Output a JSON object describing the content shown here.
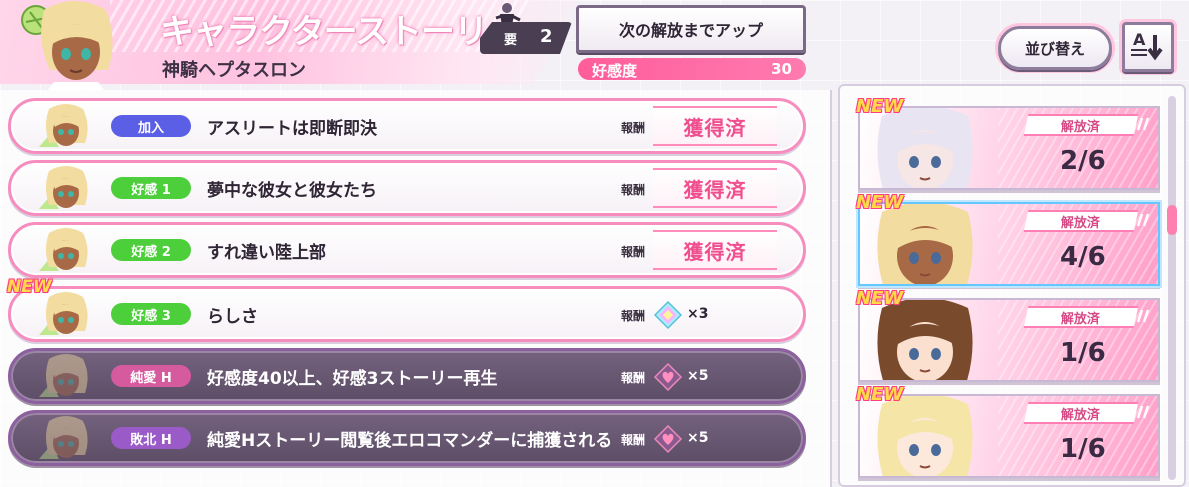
{
  "header": {
    "title": "キャラクターストーリー",
    "character_name": "神騎ヘプタスロン",
    "requirement": {
      "label": "要",
      "value": "2"
    },
    "unlock_button_label": "次の解放までアップ",
    "affinity": {
      "label": "好感度",
      "value": "30"
    }
  },
  "stories": [
    {
      "tag": "加入",
      "tag_color": "#5b5fe6",
      "title": "アスリートは即断即決",
      "reward_label": "報酬",
      "reward_text": "獲得済",
      "locked": false,
      "is_new": false
    },
    {
      "tag": "好感 1",
      "tag_color": "#4ccf3a",
      "title": "夢中な彼女と彼女たち",
      "reward_label": "報酬",
      "reward_text": "獲得済",
      "locked": false,
      "is_new": false
    },
    {
      "tag": "好感 2",
      "tag_color": "#4ccf3a",
      "title": "すれ違い陸上部",
      "reward_label": "報酬",
      "reward_text": "獲得済",
      "locked": false,
      "is_new": false
    },
    {
      "tag": "好感 3",
      "tag_color": "#4ccf3a",
      "title": "らしさ",
      "reward_label": "報酬",
      "reward_icon": "crystal-icon",
      "reward_count": "×3",
      "locked": false,
      "is_new": true,
      "new_label": "NEW"
    },
    {
      "tag": "純愛 H",
      "tag_color": "#d65a9e",
      "title": "好感度40以上、好感3ストーリー再生",
      "reward_label": "報酬",
      "reward_icon": "heart-gem-icon",
      "reward_count": "×5",
      "locked": true,
      "is_new": false
    },
    {
      "tag": "敗北 H",
      "tag_color": "#9a5ac8",
      "title": "純愛Hストーリー閲覧後エロコマンダーに捕獲される",
      "reward_label": "報酬",
      "reward_icon": "heart-gem-icon",
      "reward_count": "×5",
      "locked": true,
      "is_new": false
    }
  ],
  "sort": {
    "label": "並び替え",
    "order_icon": "sort-az-down-icon"
  },
  "characters": [
    {
      "status": "解放済",
      "count": "2/6",
      "new_label": "NEW",
      "selected": false,
      "hair": "#e9e4f2",
      "skin": "#f6e6e6"
    },
    {
      "status": "解放済",
      "count": "4/6",
      "new_label": "NEW",
      "selected": true,
      "hair": "#f3dca0",
      "skin": "#a86a46"
    },
    {
      "status": "解放済",
      "count": "1/6",
      "new_label": "NEW",
      "selected": false,
      "hair": "#7a4a2c",
      "skin": "#fbe0cf"
    },
    {
      "status": "解放済",
      "count": "1/6",
      "new_label": "NEW",
      "selected": false,
      "hair": "#f5e6a8",
      "skin": "#fde8dc"
    }
  ],
  "colors": {
    "accent_pink": "#ff5d9a",
    "reward_pink": "#f04f8f",
    "locked_row": "#5d4d66",
    "new_yellow": "#ffd94a"
  }
}
